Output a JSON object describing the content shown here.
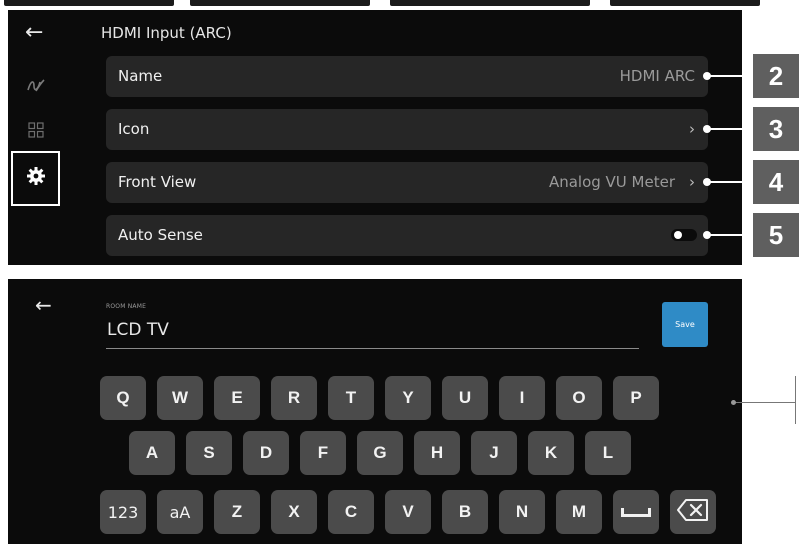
{
  "top_panel": {
    "title": "HDMI Input (ARC)",
    "rows": [
      {
        "label": "Name",
        "value": "HDMI ARC"
      },
      {
        "label": "Icon",
        "value": ""
      },
      {
        "label": "Front View",
        "value": "Analog VU Meter"
      },
      {
        "label": "Auto Sense",
        "value": ""
      }
    ],
    "auto_sense_toggle_on": true,
    "chevron": "›",
    "back_arrow": "←"
  },
  "callouts": [
    "2",
    "3",
    "4",
    "5"
  ],
  "keyboard_panel": {
    "room_name_caption": "ROOM NAME",
    "room_name_value": "LCD TV",
    "save_label": "Save",
    "keys_row1": [
      "Q",
      "W",
      "E",
      "R",
      "T",
      "Y",
      "U",
      "I",
      "O",
      "P"
    ],
    "keys_row2": [
      "A",
      "S",
      "D",
      "F",
      "G",
      "H",
      "J",
      "K",
      "L"
    ],
    "keys_row3": [
      "123",
      "aA",
      "Z",
      "X",
      "C",
      "V",
      "B",
      "N",
      "M"
    ]
  },
  "colors": {
    "panel_bg": "#0b0b0b",
    "row_bg": "#262626",
    "key_bg": "#4b4b4b",
    "save_accent": "#2f8bc6",
    "callout_bg": "#5f5f5f"
  },
  "icons": [
    "back-arrow-icon",
    "wave-logo-icon",
    "grid-icon",
    "gear-icon",
    "chevron-right-icon",
    "space-key-icon",
    "backspace-icon"
  ]
}
